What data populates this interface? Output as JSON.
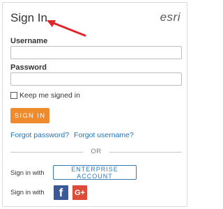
{
  "header": {
    "title": "Sign In",
    "brand": "esri"
  },
  "form": {
    "username_label": "Username",
    "username_value": "",
    "password_label": "Password",
    "password_value": "",
    "remember_label": "Keep me signed in",
    "remember_checked": false,
    "signin_label": "SIGN IN"
  },
  "links": {
    "forgot_password": "Forgot password?",
    "forgot_username": "Forgot username?"
  },
  "divider": {
    "text": "OR"
  },
  "alt_signin": {
    "enterprise_row_label": "Sign in with",
    "enterprise_button": "ENTERPRISE ACCOUNT",
    "social_row_label": "Sign in with",
    "facebook_glyph": "f",
    "google_glyph": "G+"
  },
  "colors": {
    "accent_orange": "#ef8a2d",
    "link_blue": "#1f73b7",
    "annotation_arrow": "#e0262a",
    "facebook": "#3b5998",
    "google": "#dd4b39"
  }
}
